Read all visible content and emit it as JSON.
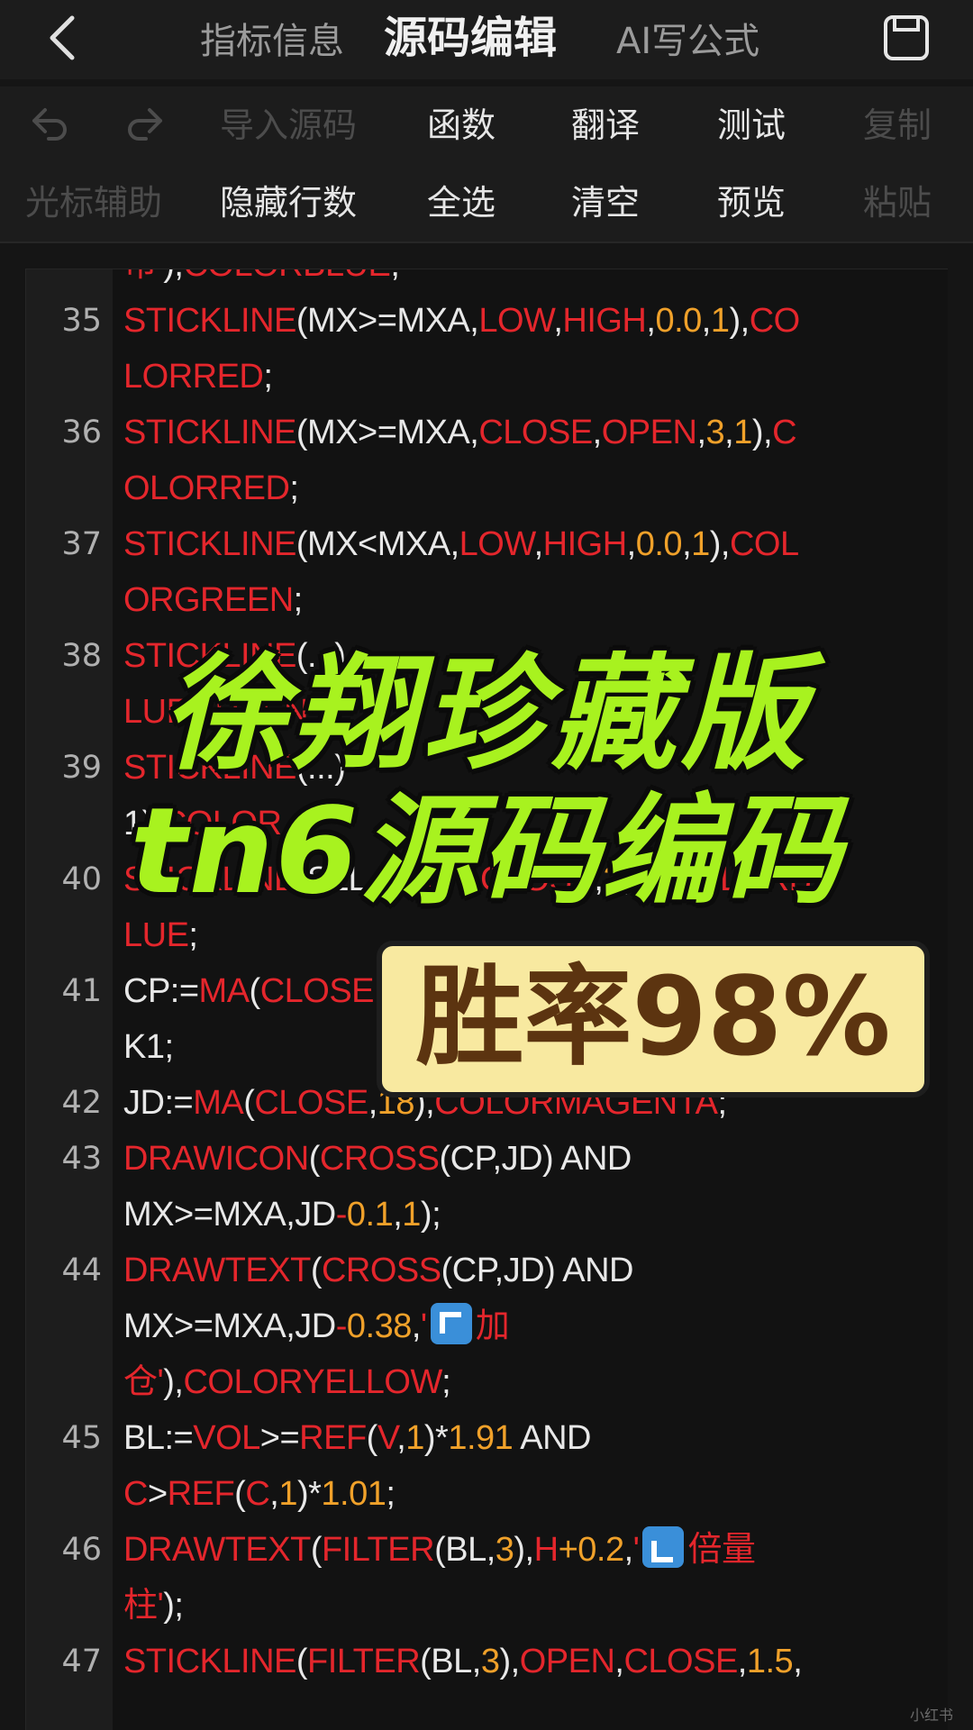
{
  "topbar": {
    "tab_info": "指标信息",
    "tab_source": "源码编辑",
    "tab_ai": "AI写公式"
  },
  "toolbar1": {
    "import": "导入源码",
    "functions": "函数",
    "translate": "翻译",
    "test": "测试",
    "copy": "复制"
  },
  "toolbar2": {
    "cursor": "光标辅助",
    "hide_lines": "隐藏行数",
    "select_all": "全选",
    "clear": "清空",
    "preview": "预览",
    "paste": "粘贴"
  },
  "editor": {
    "lines": [
      {
        "no": "",
        "text": "币'),COLORBLUE;"
      },
      {
        "no": "35",
        "text": "STICKLINE(MX>=MXA,LOW,HIGH,0.0,1),COLORRED;"
      },
      {
        "no": "36",
        "text": "STICKLINE(MX>=MXA,CLOSE,OPEN,3,1),COLORRED;"
      },
      {
        "no": "37",
        "text": "STICKLINE(MX<MXA,LOW,HIGH,0.0,1),COLORGREEN;"
      },
      {
        "no": "38",
        "text": "STICKLINE(...)"
      },
      {
        "no": "39",
        "text": "STICKLINE(...)"
      },
      {
        "no": "40",
        "text": "STICKLINE(SLL,OPEN,CLOSE,2,0),COLORBLUE;"
      },
      {
        "no": "41",
        "text": "CP:=MA(CLOSE,...),COLORBLACK1;"
      },
      {
        "no": "42",
        "text": "JD:=MA(CLOSE,18),COLORMAGENTA;"
      },
      {
        "no": "43",
        "text": "DRAWICON(CROSS(CP,JD) AND MX>=MXA,JD-0.1,1);"
      },
      {
        "no": "44",
        "text": "DRAWTEXT(CROSS(CP,JD) AND MX>=MXA,JD-0.38,'↖加仓'),COLORYELLOW;"
      },
      {
        "no": "45",
        "text": "BL:=VOL>=REF(V,1)*1.91 AND C>REF(C,1)*1.01;"
      },
      {
        "no": "46",
        "text": "DRAWTEXT(FILTER(BL,3),H+0.2,'↙倍量柱');"
      },
      {
        "no": "47",
        "text": "STICKLINE(FILTER(BL,3),OPEN,CLOSE,1.5,"
      }
    ]
  },
  "overlay": {
    "title_line1": "徐翔珍藏版",
    "title_line2": "tn6源码编码",
    "badge": "胜率98%"
  },
  "watermark": "小红书"
}
